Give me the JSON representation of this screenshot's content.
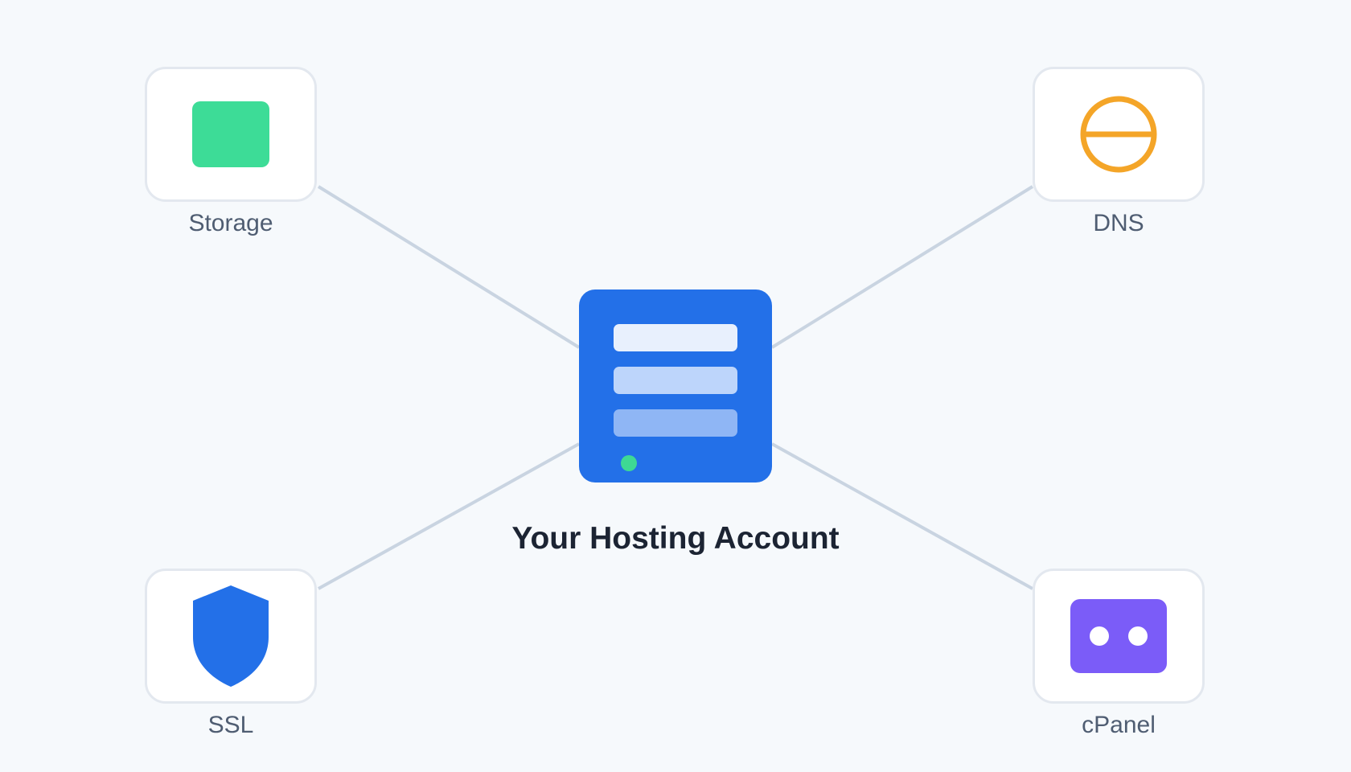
{
  "hub": {
    "title": "Your Hosting Account",
    "color": "#2370e8",
    "bar_colors": [
      "#e8f0fd",
      "#bdd5fb",
      "#8fb6f5"
    ],
    "status_led_color": "#3ed994"
  },
  "services": [
    {
      "label": "Storage",
      "icon": "storage-icon",
      "color": "#3ddc97"
    },
    {
      "label": "DNS",
      "icon": "globe-icon",
      "color": "#f4a528"
    },
    {
      "label": "SSL",
      "icon": "shield-icon",
      "color": "#2370e8"
    },
    {
      "label": "cPanel",
      "icon": "control-panel-icon",
      "color": "#7b5cf8"
    }
  ],
  "connector_color": "#c9d4e1"
}
